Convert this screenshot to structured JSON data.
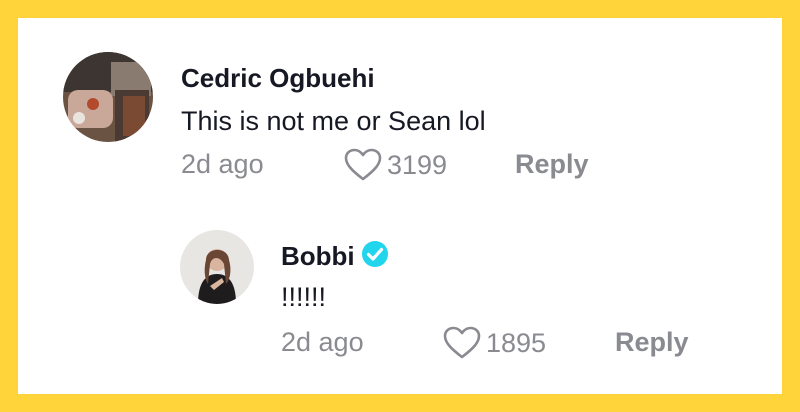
{
  "comments": [
    {
      "author": "Cedric Ogbuehi",
      "text": "This is not me or Sean lol",
      "time": "2d ago",
      "likes": "3199",
      "reply_label": "Reply",
      "avatar_icon": "profile-photo",
      "verified": false
    },
    {
      "author": "Bobbi",
      "text": "!!!!!!",
      "time": "2d ago",
      "likes": "1895",
      "reply_label": "Reply",
      "avatar_icon": "profile-photo",
      "verified": true,
      "verified_color": "#20D5EC"
    }
  ],
  "colors": {
    "frame": "#FFD43B",
    "primary_text": "#161823",
    "secondary_text": "#8A8B91"
  }
}
